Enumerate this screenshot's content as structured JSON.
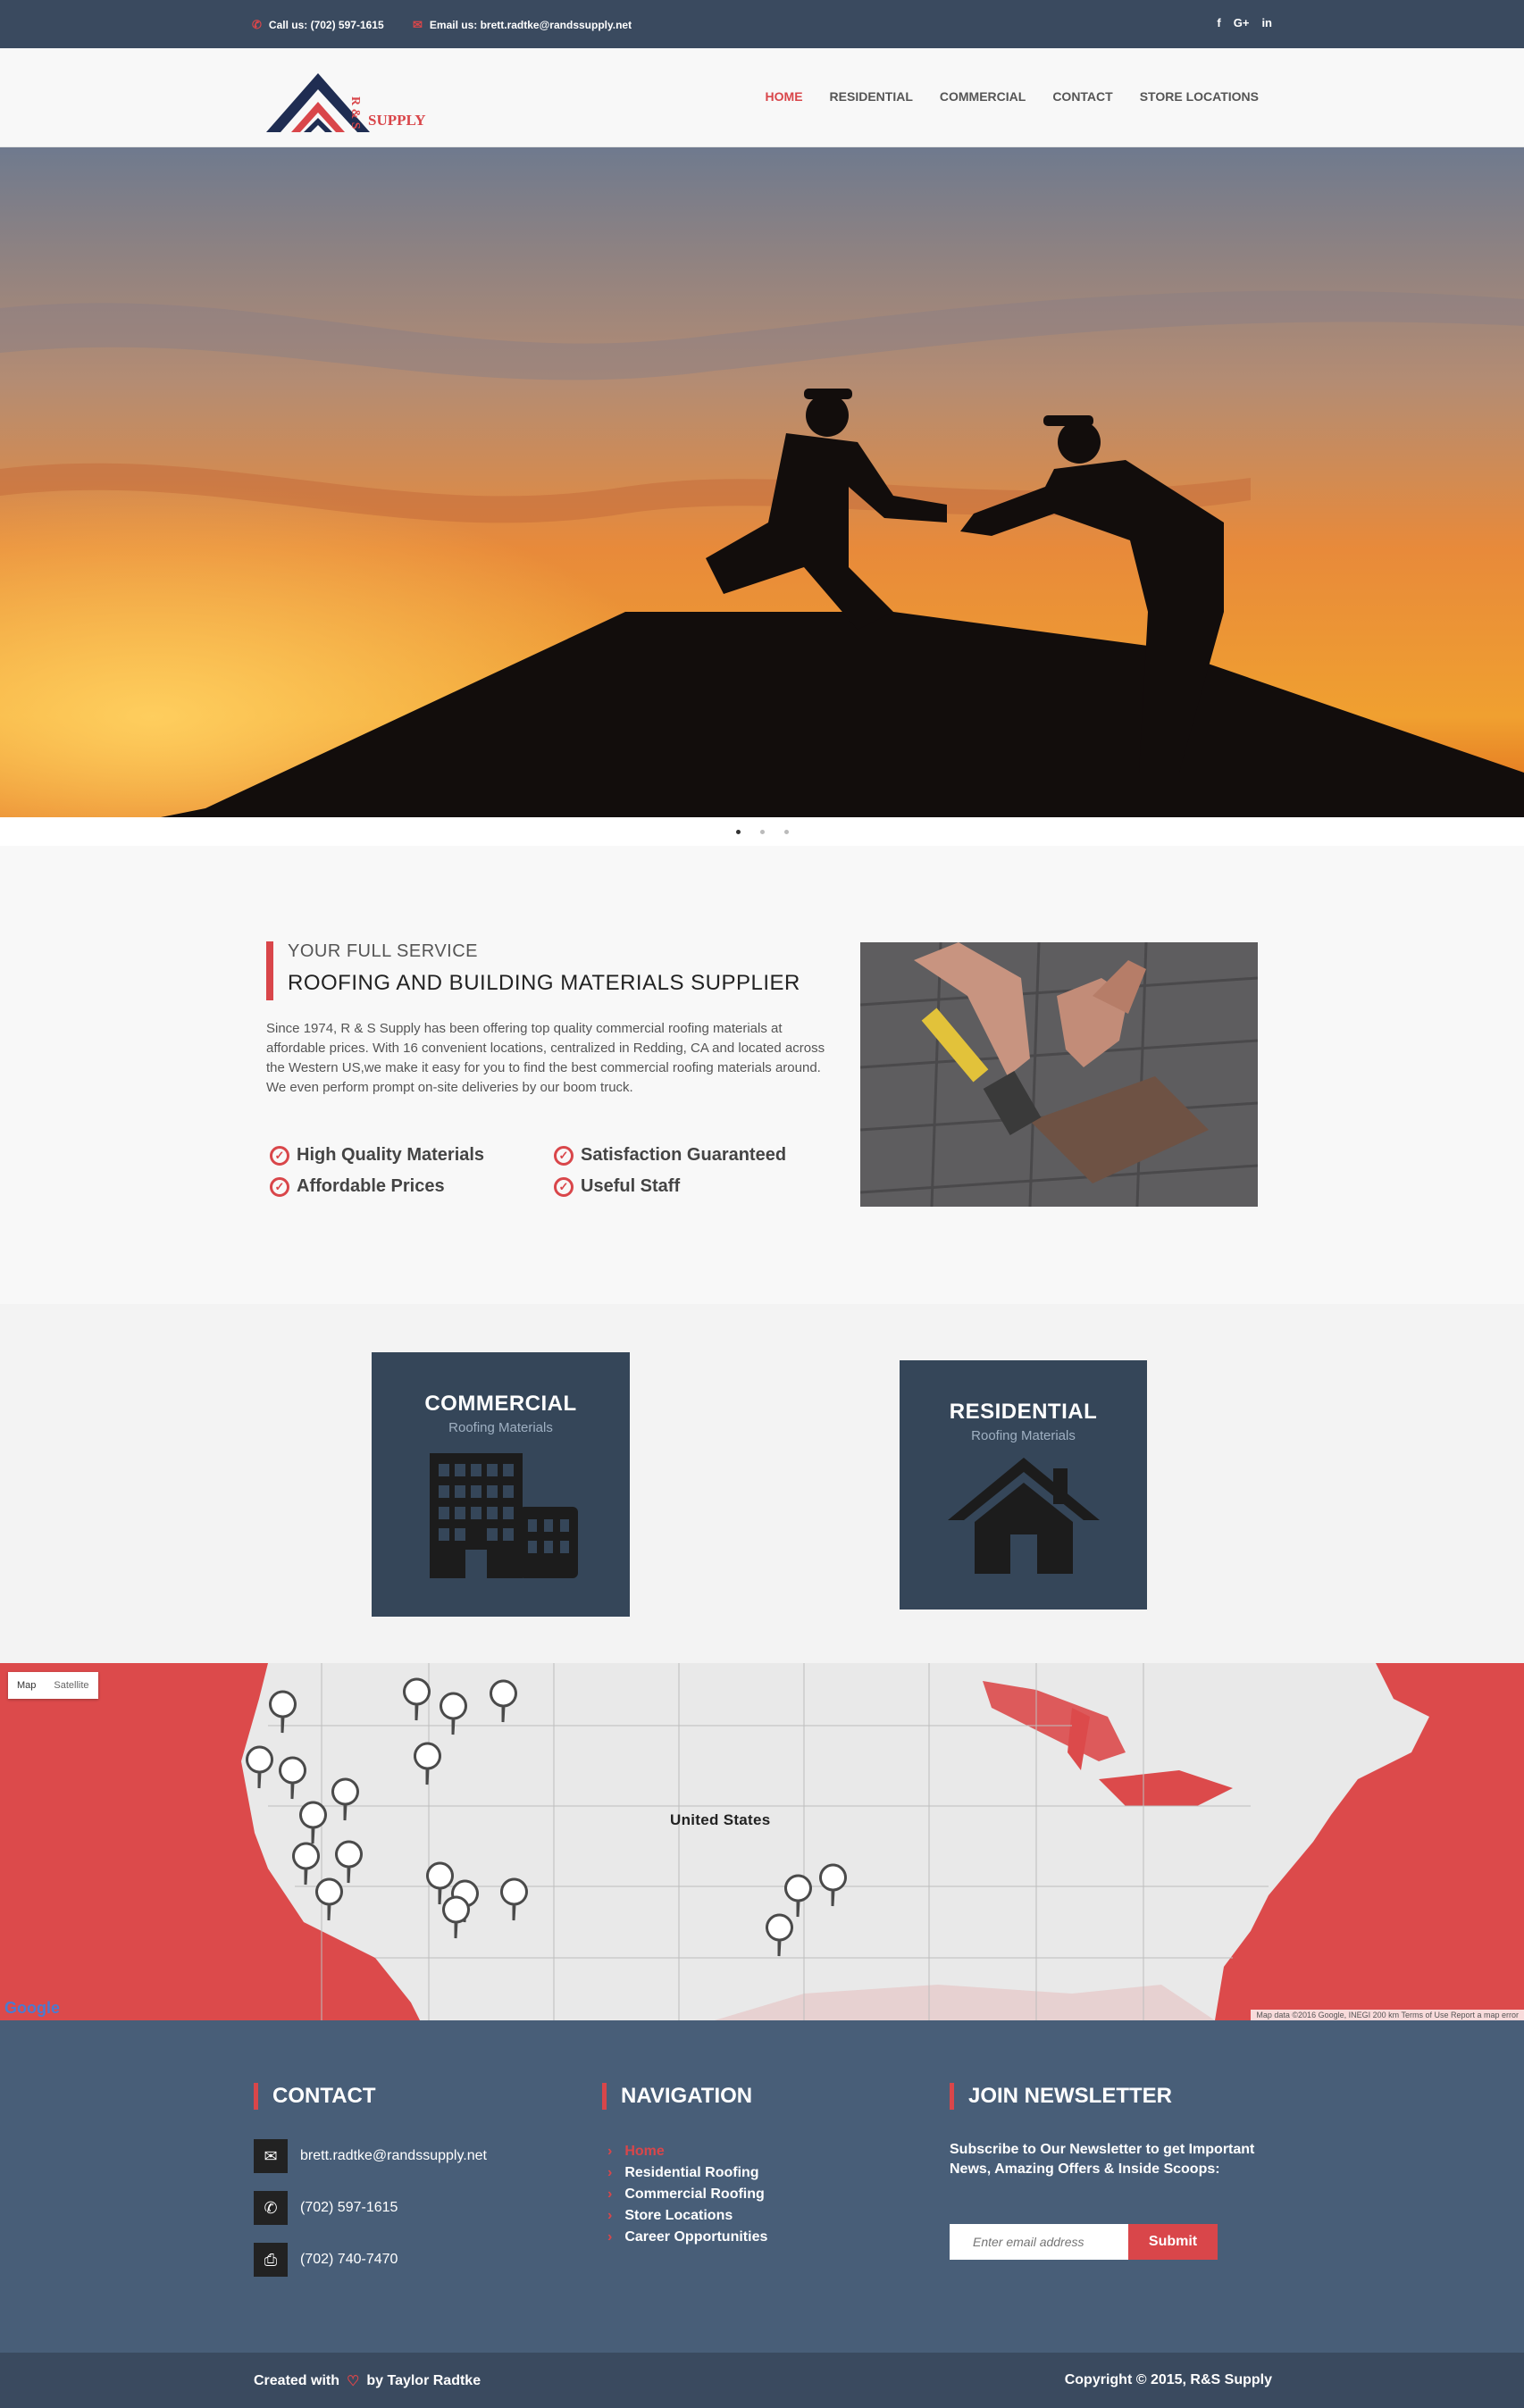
{
  "topbar": {
    "phone_label": "Call us: (702) 597-1615",
    "email_label": "Email us: brett.radtke@randssupply.net",
    "socials": [
      "f",
      "G+",
      "in"
    ]
  },
  "brand": {
    "logo_letters": "R & S",
    "logo_word": "SUPPLY"
  },
  "nav": {
    "items": [
      {
        "label": "HOME",
        "active": true
      },
      {
        "label": "RESIDENTIAL"
      },
      {
        "label": "COMMERCIAL"
      },
      {
        "label": "CONTACT"
      },
      {
        "label": "STORE LOCATIONS"
      }
    ]
  },
  "slider": {
    "slides": 3,
    "current": 1
  },
  "about": {
    "kicker": "YOUR FULL SERVICE",
    "title": "ROOFING AND BUILDING MATERIALS SUPPLIER",
    "description": "Since 1974, R & S Supply has been offering top quality commercial roofing materials at affordable prices. With 16 convenient locations, centralized in Redding, CA and located across the Western US,we make it easy for you to find the best commercial roofing materials around. We even perform prompt on-site deliveries by our boom truck.",
    "features": [
      "High Quality Materials",
      "Satisfaction Guaranteed",
      "Affordable Prices",
      "Useful Staff"
    ]
  },
  "categories": [
    {
      "title": "COMMERCIAL",
      "subtitle": "Roofing Materials",
      "icon": "building-icon"
    },
    {
      "title": "RESIDENTIAL",
      "subtitle": "Roofing Materials",
      "icon": "house-icon"
    }
  ],
  "map": {
    "type_options": [
      "Map",
      "Satellite"
    ],
    "country_label": "United States",
    "attribution": "Map data ©2016 Google, INEGI   200 km   Terms of Use   Report a map error",
    "google": "Google"
  },
  "footer": {
    "contact": {
      "title": "CONTACT",
      "email": "brett.radtke@randssupply.net",
      "phone": "(702) 597-1615",
      "fax": "(702) 740-7470"
    },
    "navigation": {
      "title": "NAVIGATION",
      "links": [
        "Home",
        "Residential Roofing",
        "Commercial Roofing",
        "Store Locations",
        "Career Opportunities"
      ]
    },
    "newsletter": {
      "title": "JOIN NEWSLETTER",
      "text": "Subscribe to Our Newsletter to get Important News, Amazing Offers & Inside Scoops:",
      "placeholder": "Enter email address",
      "button": "Submit"
    }
  },
  "bottom": {
    "created_with": "Created with",
    "by": "by Taylor Radtke",
    "copyright": "Copyright © 2015, R&S Supply"
  },
  "colors": {
    "accent": "#d9464a",
    "dark": "#3a4a5f",
    "card": "#354659",
    "footer": "#485e78"
  }
}
